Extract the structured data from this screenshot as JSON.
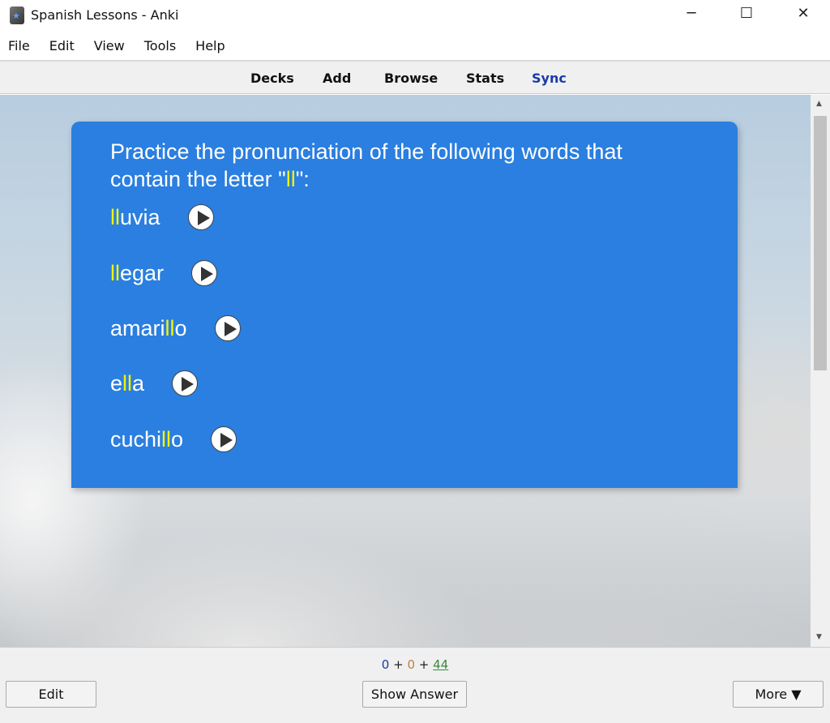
{
  "window": {
    "title": "Spanish Lessons - Anki",
    "minimize": "─",
    "maximize": "☐",
    "close": "✕"
  },
  "menu": [
    "File",
    "Edit",
    "View",
    "Tools",
    "Help"
  ],
  "toolbar": {
    "decks": "Decks",
    "add": "Add",
    "browse": "Browse",
    "stats": "Stats",
    "sync": "Sync",
    "sync_color": "#1a3aa8"
  },
  "card": {
    "prompt_pre": "Practice the pronunciation of the following words that contain the letter \"",
    "prompt_hl": "ll",
    "prompt_post": "\":",
    "bg": "#2a7fe0",
    "highlight": "#f4f400",
    "words": [
      {
        "pre": "",
        "hl": "ll",
        "post": "uvia"
      },
      {
        "pre": "",
        "hl": "ll",
        "post": "egar"
      },
      {
        "pre": "amari",
        "hl": "ll",
        "post": "o"
      },
      {
        "pre": "e",
        "hl": "ll",
        "post": "a"
      },
      {
        "pre": "cuchi",
        "hl": "ll",
        "post": "o"
      }
    ]
  },
  "counts": {
    "new": "0",
    "learn": "0",
    "review": "44",
    "sep": "+"
  },
  "buttons": {
    "edit": "Edit",
    "show_answer": "Show Answer",
    "more": "More ▼"
  }
}
